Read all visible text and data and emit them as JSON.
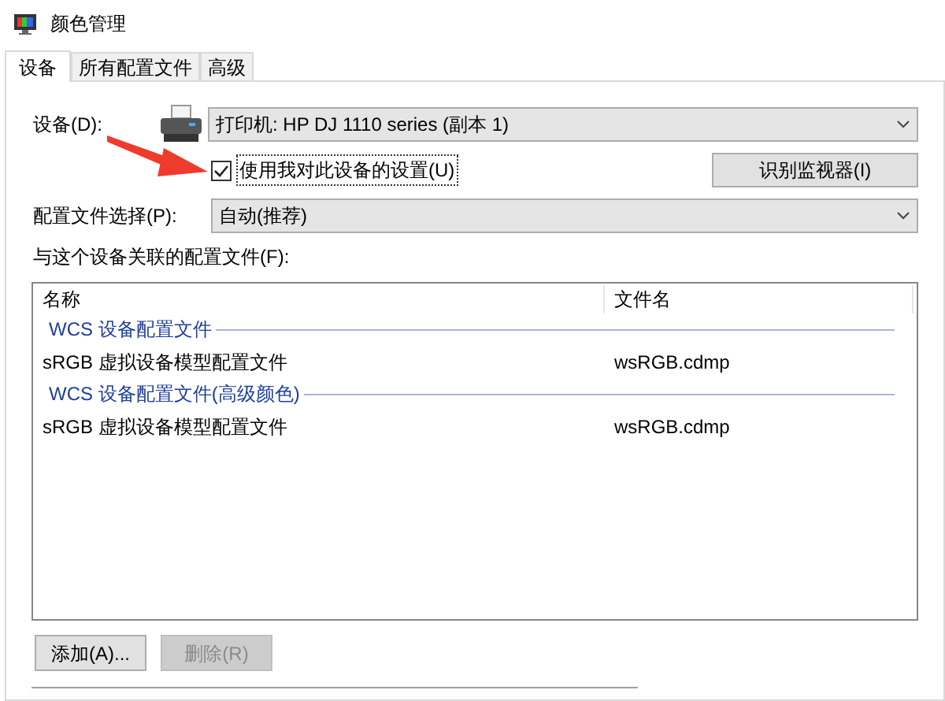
{
  "window": {
    "title": "颜色管理"
  },
  "tabs": [
    {
      "label": "设备",
      "selected": true
    },
    {
      "label": "所有配置文件",
      "selected": false
    },
    {
      "label": "高级",
      "selected": false
    }
  ],
  "device": {
    "label": "设备(D):",
    "value": "打印机: HP DJ 1110 series (副本 1)"
  },
  "use_my_settings": {
    "label": "使用我对此设备的设置(U)",
    "checked": true
  },
  "identify_button": "识别监视器(I)",
  "profile_selection": {
    "label": "配置文件选择(P):",
    "value": "自动(推荐)"
  },
  "profiles": {
    "label": "与这个设备关联的配置文件(F):",
    "columns": [
      "名称",
      "文件名"
    ],
    "rows": [
      {
        "kind": "group",
        "name": "WCS 设备配置文件"
      },
      {
        "kind": "item",
        "name": "sRGB 虚拟设备模型配置文件",
        "file": "wsRGB.cdmp"
      },
      {
        "kind": "group",
        "name": "WCS 设备配置文件(高级颜色)"
      },
      {
        "kind": "item",
        "name": "sRGB 虚拟设备模型配置文件",
        "file": "wsRGB.cdmp"
      }
    ]
  },
  "buttons": [
    {
      "label": "添加(A)...",
      "disabled": false
    },
    {
      "label": "删除(R)",
      "disabled": true
    }
  ]
}
